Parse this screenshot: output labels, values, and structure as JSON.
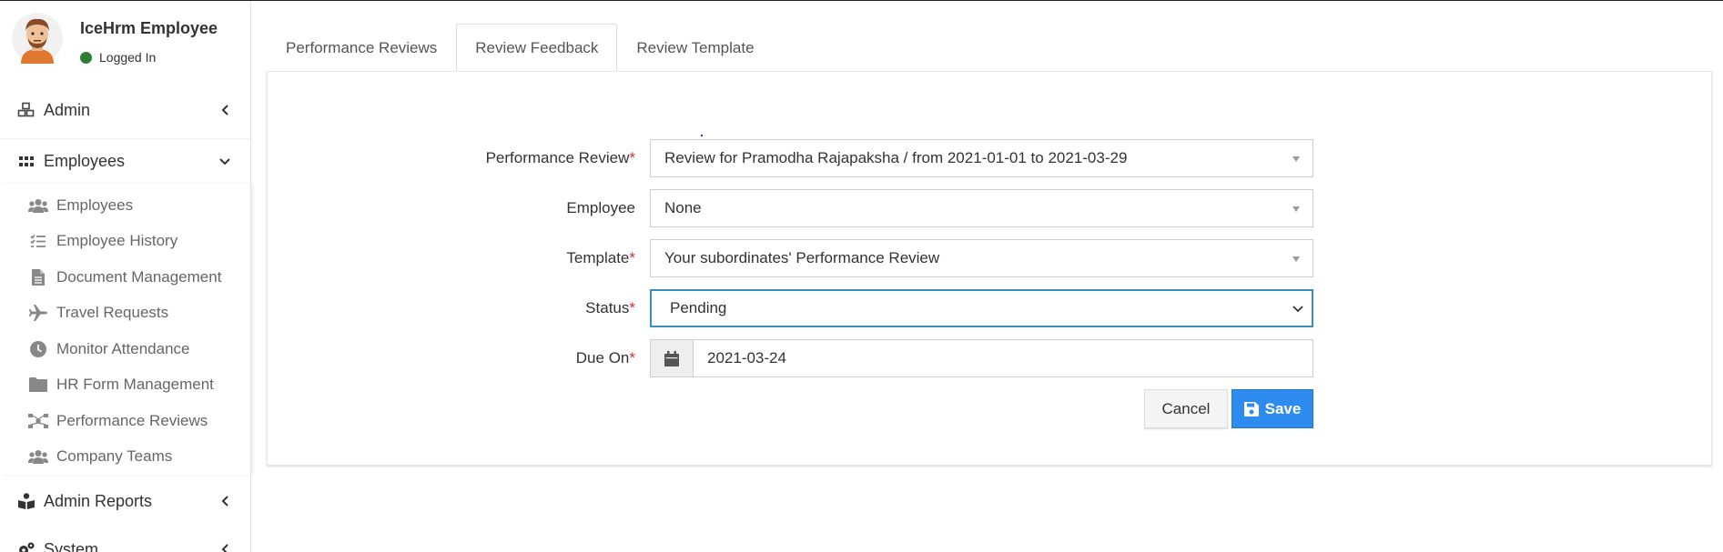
{
  "user": {
    "name": "IceHrm Employee",
    "status": "Logged In"
  },
  "menu": {
    "admin": "Admin",
    "employees": "Employees",
    "admin_reports": "Admin Reports",
    "system": "System"
  },
  "submenu": [
    {
      "label": "Employees",
      "icon": "users-icon"
    },
    {
      "label": "Employee History",
      "icon": "list-check-icon"
    },
    {
      "label": "Document Management",
      "icon": "file-icon"
    },
    {
      "label": "Travel Requests",
      "icon": "plane-icon"
    },
    {
      "label": "Monitor Attendance",
      "icon": "clock-icon"
    },
    {
      "label": "HR Form Management",
      "icon": "folder-icon"
    },
    {
      "label": "Performance Reviews",
      "icon": "sitemap-icon"
    },
    {
      "label": "Company Teams",
      "icon": "users-icon"
    }
  ],
  "tabs": [
    {
      "label": "Performance Reviews",
      "active": false
    },
    {
      "label": "Review Feedback",
      "active": true
    },
    {
      "label": "Review Template",
      "active": false
    }
  ],
  "form": {
    "performance_review": {
      "label": "Performance Review",
      "required": "*",
      "value": "Review for Pramodha Rajapaksha / from 2021-01-01 to 2021-03-29"
    },
    "employee": {
      "label": "Employee",
      "value": "None"
    },
    "template": {
      "label": "Template",
      "required": "*",
      "value": "Your subordinates' Performance Review"
    },
    "status": {
      "label": "Status",
      "required": "*",
      "value": "Pending"
    },
    "due_on": {
      "label": "Due On",
      "required": "*",
      "value": "2021-03-24"
    }
  },
  "buttons": {
    "cancel": "Cancel",
    "save": "Save"
  },
  "colors": {
    "accent": "#2e8cf0",
    "required": "#d32f2f",
    "online": "#2e7d32",
    "focus": "#3c8dbc"
  }
}
